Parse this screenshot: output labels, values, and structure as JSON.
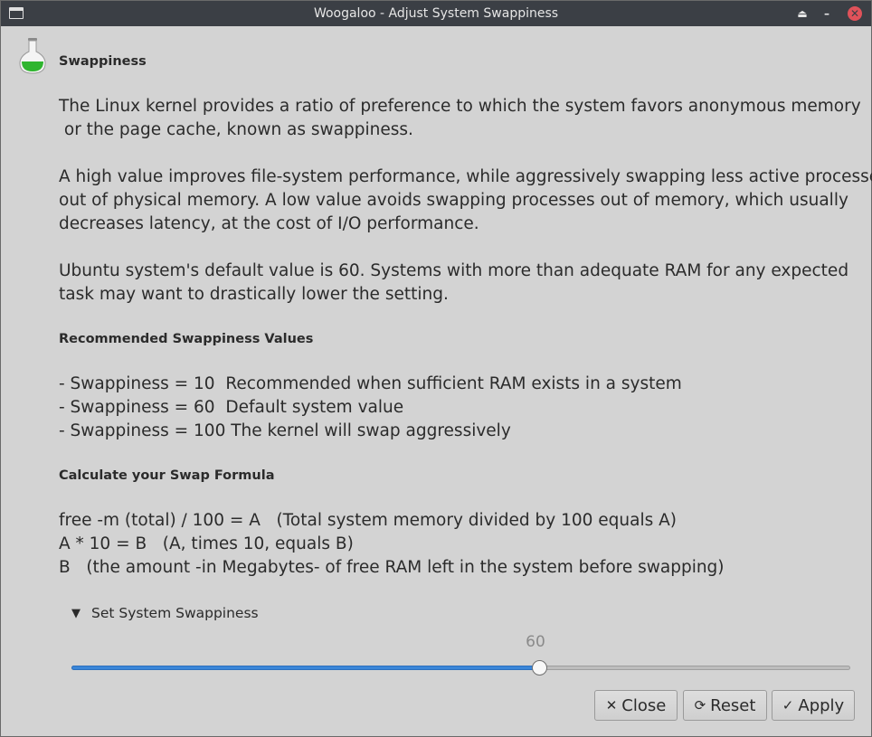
{
  "window": {
    "title": "Woogaloo - Adjust System Swappiness",
    "controls": {
      "shade": "⏏",
      "minimize": "–",
      "close": "✕"
    }
  },
  "header": {
    "title": "Swappiness"
  },
  "content": {
    "intro": "The Linux kernel provides a ratio of preference to which the system favors anonymous memory\n or the page cache, known as swappiness.",
    "explanation": "A high value improves file-system performance, while aggressively swapping less active processes\nout of physical memory. A low value avoids swapping processes out of memory, which usually\ndecreases latency, at the cost of I/O performance.",
    "default_note": "Ubuntu system's default value is 60. Systems with more than adequate RAM for any expected\ntask may want to drastically lower the setting.",
    "recommended_heading": "Recommended Swappiness Values",
    "recommended": [
      "- Swappiness = 10  Recommended when sufficient RAM exists in a system",
      "- Swappiness = 60  Default system value",
      "- Swappiness = 100 The kernel will swap aggressively"
    ],
    "formula_heading": "Calculate your Swap Formula",
    "formula": [
      "free -m (total) / 100 = A   (Total system memory divided by 100 equals A)",
      "A * 10 = B   (A, times 10, equals B)",
      "B   (the amount -in Megabytes- of free RAM left in the system before swapping)"
    ]
  },
  "expander": {
    "arrow": "▼",
    "label": "Set System Swappiness"
  },
  "slider": {
    "value": "60",
    "min": 0,
    "max": 100,
    "fraction": 0.6
  },
  "buttons": {
    "close": {
      "icon": "✕",
      "label": "Close"
    },
    "reset": {
      "icon": "⟳",
      "label": "Reset"
    },
    "apply": {
      "icon": "✓",
      "label": "Apply"
    }
  },
  "colors": {
    "accent": "#3a86d8",
    "titlebar": "#3b3f45",
    "close_button": "#e0525a",
    "flask_liquid": "#2fb52f"
  },
  "icons": {
    "app": "flask-icon"
  }
}
